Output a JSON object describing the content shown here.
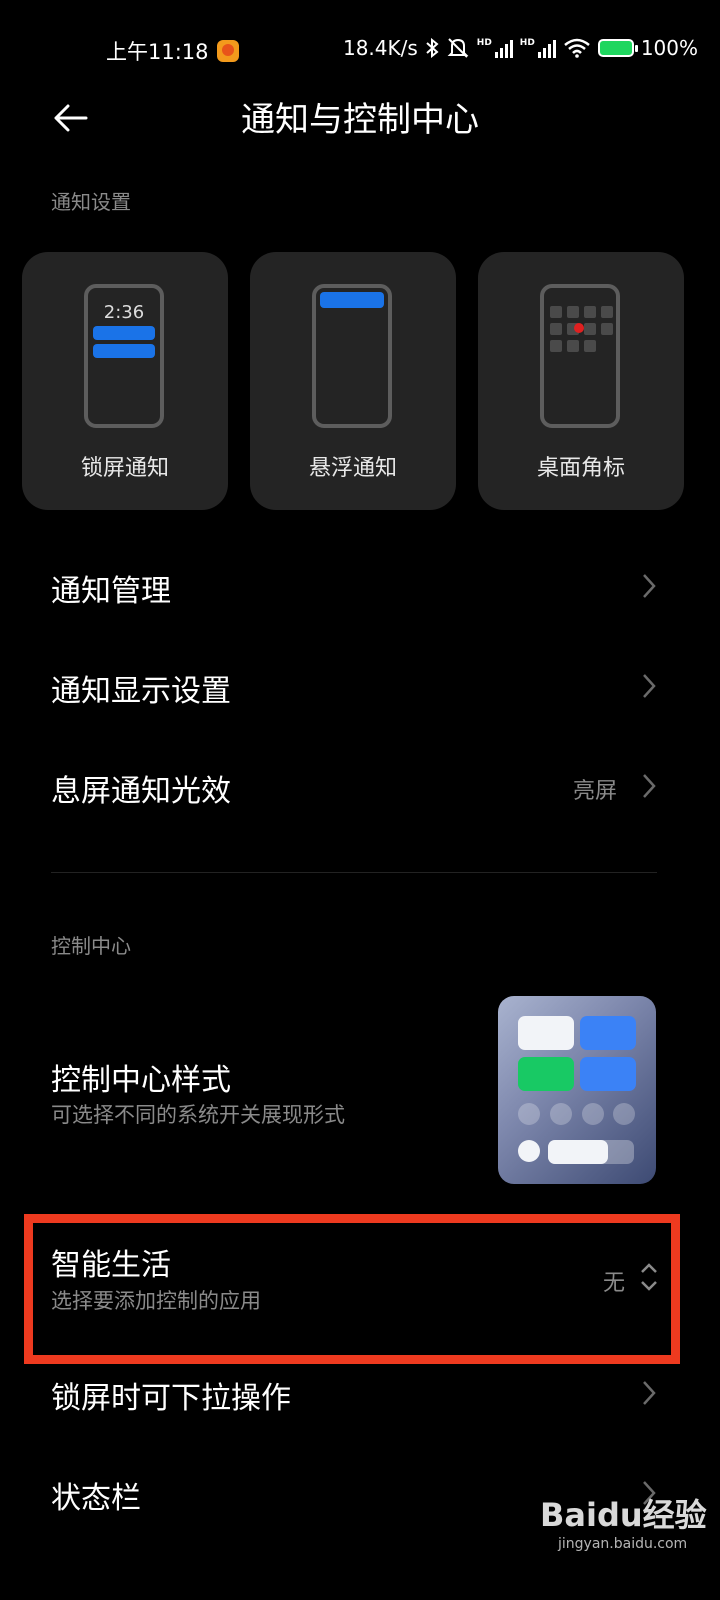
{
  "status_bar": {
    "time": "上午11:18",
    "net_speed": "18.4K/s",
    "battery": "100%"
  },
  "header": {
    "title": "通知与控制中心"
  },
  "notification_section": {
    "label": "通知设置",
    "tiles": [
      {
        "label": "锁屏通知",
        "clock": "2:36"
      },
      {
        "label": "悬浮通知"
      },
      {
        "label": "桌面角标"
      }
    ],
    "rows": [
      {
        "title": "通知管理"
      },
      {
        "title": "通知显示设置"
      },
      {
        "title": "息屏通知光效",
        "value": "亮屏"
      }
    ]
  },
  "control_section": {
    "label": "控制中心",
    "style_row": {
      "title": "控制中心样式",
      "subtitle": "可选择不同的系统开关展现形式"
    },
    "smart_life": {
      "title": "智能生活",
      "subtitle": "选择要添加控制的应用",
      "value": "无"
    },
    "rows": [
      {
        "title": "锁屏时可下拉操作"
      },
      {
        "title": "状态栏"
      }
    ]
  },
  "watermark": {
    "brand": "Baidu经验",
    "url": "jingyan.baidu.com"
  },
  "colors": {
    "accent_blue": "#1a73e8",
    "highlight_red": "#ee3a1f",
    "background": "#000000"
  }
}
